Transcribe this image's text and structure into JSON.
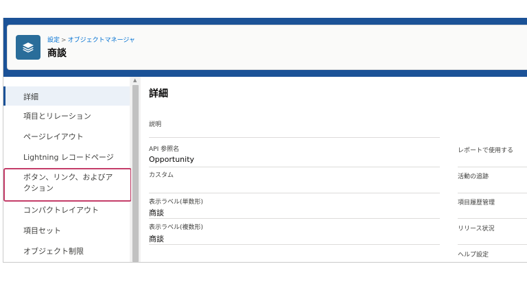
{
  "header": {
    "breadcrumb_setup": "設定",
    "breadcrumb_sep": ">",
    "breadcrumb_object_manager": "オブジェクトマネージャ",
    "object_title": "商談",
    "object_icon": "layers-icon"
  },
  "sidebar": {
    "items": [
      {
        "label": "詳細"
      },
      {
        "label": "項目とリレーション"
      },
      {
        "label": "ページレイアウト"
      },
      {
        "label": "Lightning レコードページ"
      },
      {
        "label": "ボタン、リンク、およびア"
      },
      {
        "label": "クション"
      },
      {
        "label": "コンパクトレイアウト"
      },
      {
        "label": "項目セット"
      },
      {
        "label": "オブジェクト制限"
      }
    ],
    "active_index": 0
  },
  "detail": {
    "title": "詳細",
    "description_label": "説明",
    "api_name_label": "API 参照名",
    "api_name_value": "Opportunity",
    "custom_label": "カスタム",
    "singular_label": "表示ラベル(単数形)",
    "singular_value": "商談",
    "plural_label": "表示ラベル(複数形)",
    "plural_value": "商談",
    "right_labels": {
      "reports": "レポートで使用する",
      "activities": "活動の追跡",
      "history": "項目履歴管理",
      "release": "リリース状況",
      "help": "ヘルプ設定"
    }
  },
  "colors": {
    "brand_blue": "#1b5297",
    "icon_blue": "#2a6d9a",
    "link_blue": "#0070d2",
    "highlight_pink": "#c43c68"
  }
}
